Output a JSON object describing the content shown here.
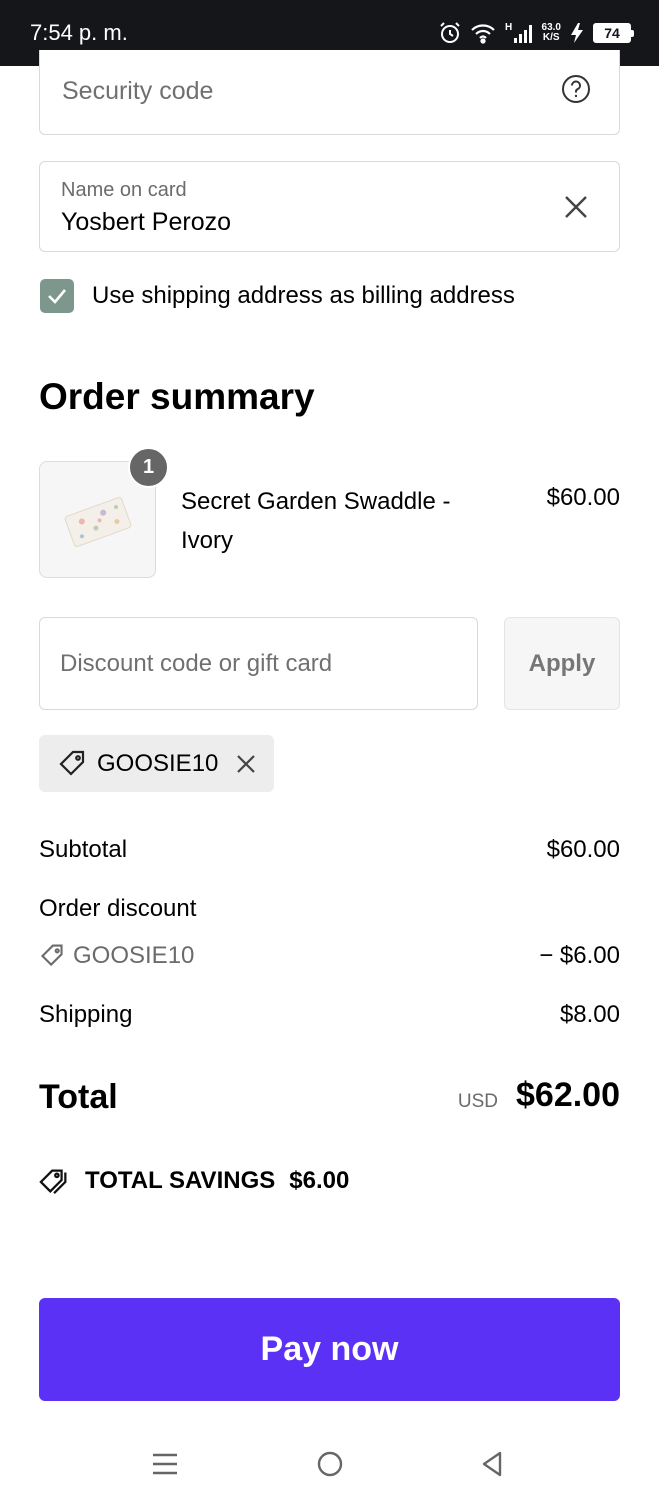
{
  "status_bar": {
    "time": "7:54 p. m.",
    "net_speed_value": "63.0",
    "net_speed_unit": "K/S",
    "signal_type": "H",
    "battery": "74",
    "icons": [
      "alarm-icon",
      "wifi-icon",
      "signal-icon",
      "charging-icon",
      "battery-icon"
    ]
  },
  "payment": {
    "security_code_placeholder": "Security code",
    "name_on_card_label": "Name on card",
    "name_on_card_value": "Yosbert Perozo",
    "billing_checkbox_label": "Use shipping address as billing address",
    "billing_checked": true
  },
  "order_summary": {
    "title": "Order summary",
    "product": {
      "quantity": "1",
      "name": "Secret Garden Swaddle - Ivory",
      "price": "$60.00"
    },
    "discount": {
      "placeholder": "Discount code or gift card",
      "apply_label": "Apply",
      "applied_code": "GOOSIE10"
    },
    "subtotal_label": "Subtotal",
    "subtotal_value": "$60.00",
    "order_discount_label": "Order discount",
    "order_discount_code": "GOOSIE10",
    "order_discount_value": "− $6.00",
    "shipping_label": "Shipping",
    "shipping_value": "$8.00",
    "total_label": "Total",
    "total_currency": "USD",
    "total_value": "$62.00",
    "savings_label": "TOTAL SAVINGS",
    "savings_value": "$6.00"
  },
  "pay_button_label": "Pay now",
  "colors": {
    "accent": "#5b31f5",
    "checkbox": "#7e978c",
    "status_bar": "#14161a"
  }
}
